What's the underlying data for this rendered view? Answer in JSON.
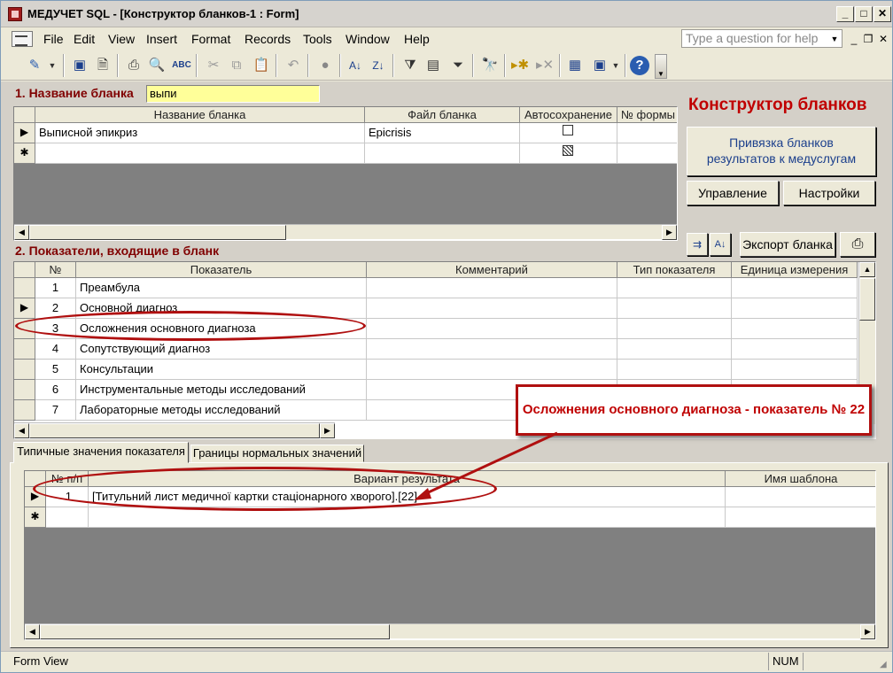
{
  "window": {
    "title": "МЕДУЧЕТ SQL - [Конструктор бланков-1 : Form]"
  },
  "menu": {
    "items": [
      "File",
      "Edit",
      "View",
      "Insert",
      "Format",
      "Records",
      "Tools",
      "Window",
      "Help"
    ],
    "help_placeholder": "Type a question for help"
  },
  "section1": {
    "label": "1. Название бланка",
    "input_value": "выпи",
    "columns": [
      "Название бланка",
      "Файл бланка",
      "Автосохранение",
      "№ формы"
    ],
    "rows": [
      {
        "name": "Выписной эпикриз",
        "file": "Epicrisis",
        "autosave": false,
        "form": ""
      }
    ]
  },
  "right_panel": {
    "title": "Конструктор бланков",
    "link_button": "Привязка бланков результатов к медуслугам",
    "manage_button": "Управление",
    "settings_button": "Настройки",
    "export_button": "Экспорт бланка"
  },
  "section2": {
    "label": "2. Показатели, входящие в бланк",
    "columns": [
      "№",
      "Показатель",
      "Комментарий",
      "Тип показателя",
      "Единица измерения"
    ],
    "rows": [
      {
        "n": "1",
        "name": "Преамбула"
      },
      {
        "n": "2",
        "name": "Основной диагноз"
      },
      {
        "n": "3",
        "name": "Осложнения основного диагноза"
      },
      {
        "n": "4",
        "name": "Сопутствующий диагноз"
      },
      {
        "n": "5",
        "name": "Консультации"
      },
      {
        "n": "6",
        "name": "Инструментальные методы исследований"
      },
      {
        "n": "7",
        "name": "Лабораторные методы исследований"
      }
    ]
  },
  "callout": {
    "text": "Осложнения основного диагноза - показатель № 22"
  },
  "tabs": [
    "Типичные значения показателя",
    "Границы нормальных значений"
  ],
  "section3": {
    "columns": [
      "№ п/п",
      "Вариант результата",
      "Имя шаблона"
    ],
    "rows": [
      {
        "n": "1",
        "variant": "[Титульний лист медичної картки стаціонарного хворого].[22]",
        "template": ""
      }
    ]
  },
  "status": {
    "left": "Form View",
    "right": "NUM"
  },
  "colors": {
    "accent_red": "#c00000",
    "highlight_yellow": "#ffff99",
    "grid_gray": "#808080"
  }
}
